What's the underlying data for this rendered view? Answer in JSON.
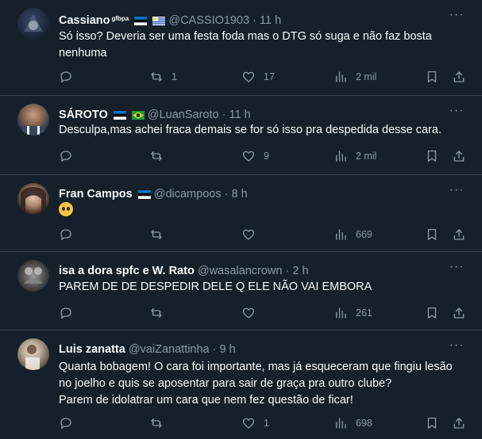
{
  "tweets": [
    {
      "name": "Cassiano",
      "name_suffix": "gfbpa",
      "handle": "@CASSIO1903",
      "separator": "·",
      "time": "11 h",
      "text_lines": [
        "Só isso? Deveria ser uma festa foda mas o DTG só suga e não faz bosta",
        "nenhuma"
      ],
      "replies": "",
      "retweets": "1",
      "likes": "17",
      "views": "2 mil"
    },
    {
      "name": "SÁROTO",
      "handle": "@LuanSaroto",
      "separator": "·",
      "time": "11 h",
      "text_lines": [
        "Desculpa,mas achei fraca demais se for só isso pra despedida desse cara."
      ],
      "replies": "",
      "retweets": "",
      "likes": "9",
      "views": "2 mil"
    },
    {
      "name": "Fran Campos",
      "handle": "@dicampoos",
      "separator": "·",
      "time": "8 h",
      "text_lines": [
        ""
      ],
      "emoji": "pleading-face",
      "replies": "",
      "retweets": "",
      "likes": "",
      "views": "669"
    },
    {
      "name": "isa a dora spfc e W. Rato",
      "handle": "@wasalancrown",
      "separator": "·",
      "time": "2 h",
      "text_lines": [
        "PAREM DE DE DESPEDIR DELE Q ELE NÃO VAI EMBORA"
      ],
      "replies": "",
      "retweets": "",
      "likes": "",
      "views": "261"
    },
    {
      "name": "Luis zanatta",
      "handle": "@vaiZanattinha",
      "separator": "·",
      "time": "9 h",
      "text_lines": [
        "Quanta bobagem! O cara foi importante, mas já esqueceram que fingiu lesão",
        "no joelho e quis se aposentar para sair de graça pra outro clube?",
        "Parem de idolatrar um cara que nem fez questão de ficar!"
      ],
      "replies": "",
      "retweets": "",
      "likes": "1",
      "views": "698"
    }
  ],
  "colors": {
    "background": "#15202b",
    "divider": "#38444d",
    "muted_text": "#8b98a5",
    "primary_text": "#f7f9f9"
  },
  "icons": [
    "more-icon",
    "reply-icon",
    "retweet-icon",
    "like-icon",
    "views-icon",
    "bookmark-icon",
    "share-icon"
  ]
}
